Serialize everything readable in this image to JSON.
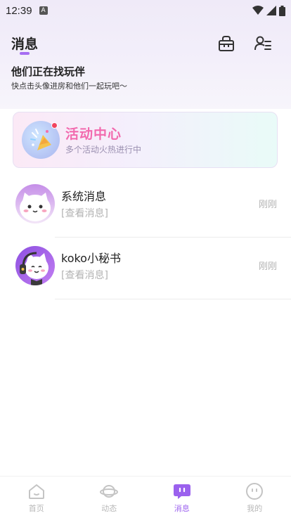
{
  "status_bar": {
    "time": "12:39",
    "notification_badge": "A"
  },
  "header": {
    "title": "消息"
  },
  "banner": {
    "title": "他们正在找玩伴",
    "subtitle": "快点击头像进房和他们一起玩吧〜"
  },
  "activity_center": {
    "title": "活动中心",
    "subtitle": "多个活动火热进行中"
  },
  "messages": [
    {
      "name": "系统消息",
      "preview": "[查看消息]",
      "time": "刚刚"
    },
    {
      "name": "koko小秘书",
      "preview": "[查看消息]",
      "time": "刚刚"
    }
  ],
  "tabs": [
    {
      "label": "首页",
      "icon": "home-icon"
    },
    {
      "label": "动态",
      "icon": "planet-icon"
    },
    {
      "label": "消息",
      "icon": "chat-icon"
    },
    {
      "label": "我的",
      "icon": "profile-face-icon"
    }
  ],
  "active_tab": "消息",
  "colors": {
    "accent": "#9b61ee",
    "activity_title": "#f26aae",
    "muted_text": "#b3b3b3"
  }
}
